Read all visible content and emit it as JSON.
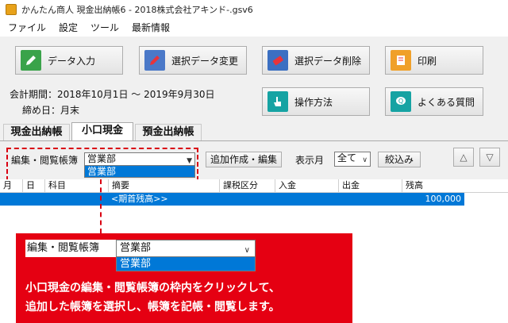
{
  "window": {
    "title": "かんたん商人 現金出納帳6 - 2018株式会社アキンド-.gsv6"
  },
  "menu": [
    "ファイル",
    "設定",
    "ツール",
    "最新情報"
  ],
  "toolbar": {
    "data_entry": "データ入力",
    "edit_data": "選択データ変更",
    "delete_data": "選択データ削除",
    "print": "印刷",
    "howto": "操作方法",
    "faq": "よくある質問"
  },
  "fiscal": {
    "period": "会計期間：2018年10月1日 ～ 2019年9月30日",
    "closing": "締め日：月末"
  },
  "tabs": [
    "現金出納帳",
    "小口現金",
    "預金出納帳"
  ],
  "filter": {
    "ledger_label": "編集・閲覧帳簿",
    "ledger_value": "営業部",
    "ledger_dropdown_item": "営業部",
    "add_edit_button": "追加作成・編集",
    "month_label": "表示月",
    "month_value": "全て",
    "narrow_button": "絞込み",
    "up_button": "△",
    "down_button": "▽"
  },
  "table": {
    "headers": [
      "月",
      "日",
      "科目",
      "摘要",
      "課税区分",
      "入金",
      "出金",
      "残高"
    ],
    "rows": [
      {
        "desc": "<期首残高>>",
        "balance": "100,000"
      }
    ]
  },
  "callout": {
    "label": "編集・閲覧帳簿",
    "select_value": "営業部",
    "dropdown_item": "営業部",
    "line1": "小口現金の編集・閲覧帳簿の枠内をクリックして、",
    "line2": "追加した帳簿を選択し、帳簿を記帳・閲覧します。"
  },
  "colors": {
    "accent_red": "#e50012",
    "selection_blue": "#0078d7"
  }
}
